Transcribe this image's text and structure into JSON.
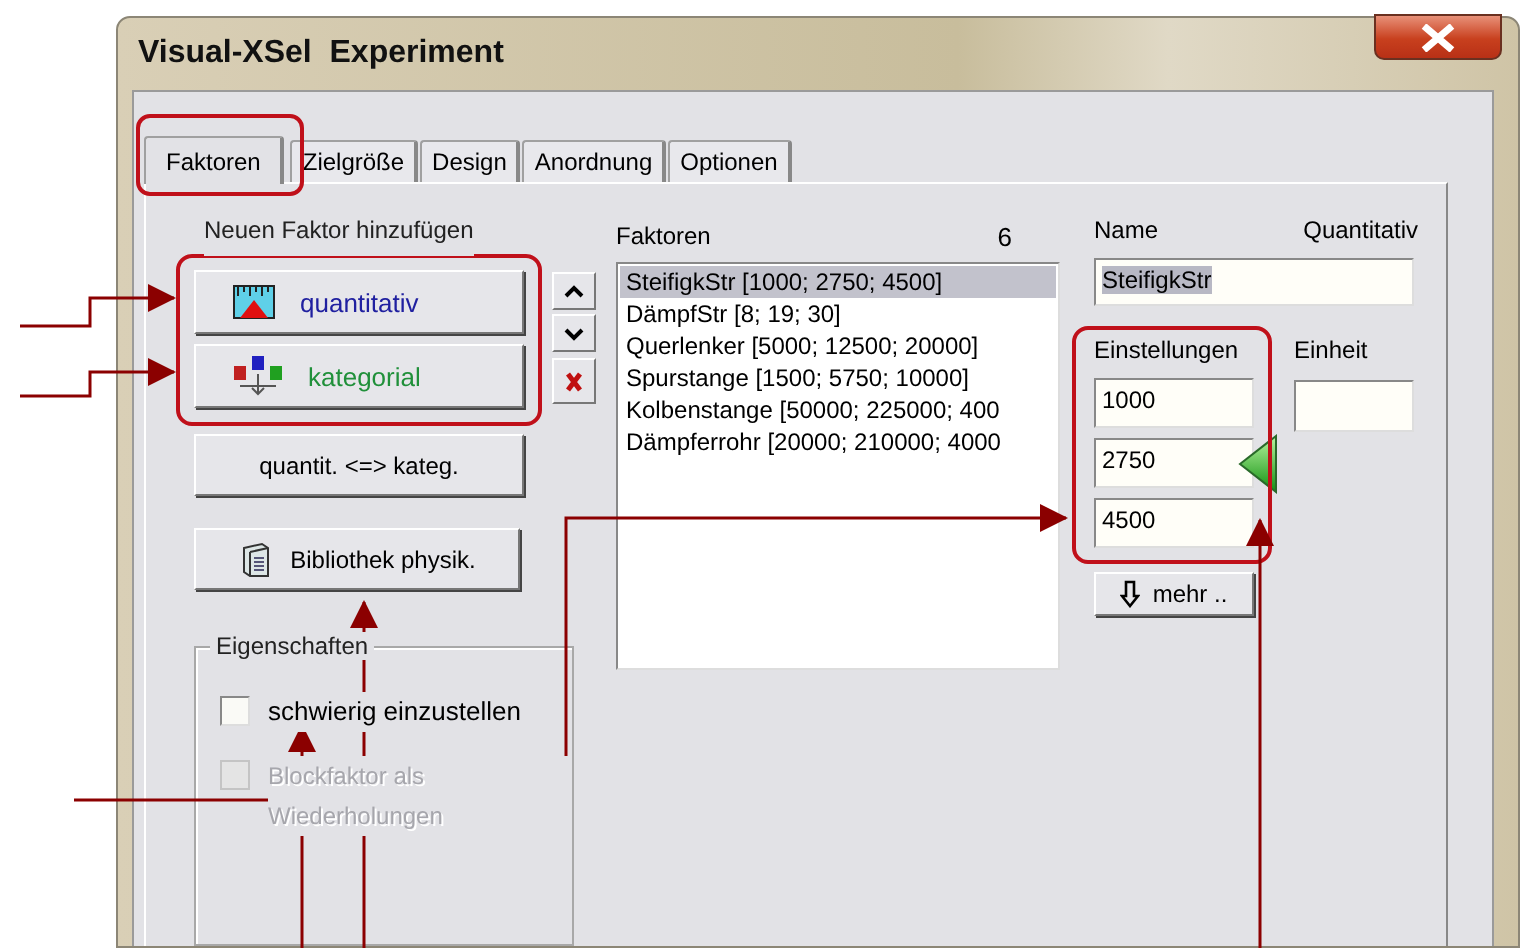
{
  "window": {
    "title": "Visual-XSel  Experiment"
  },
  "tabs": [
    {
      "label": "Faktoren",
      "selected": true
    },
    {
      "label": "Zielgröße",
      "selected": false
    },
    {
      "label": "Design",
      "selected": false
    },
    {
      "label": "Anordnung",
      "selected": false
    },
    {
      "label": "Optionen",
      "selected": false
    }
  ],
  "new_factor": {
    "label": "Neuen Faktor hinzufügen",
    "buttons": [
      {
        "kind": "quantitative",
        "label": "quantitativ"
      },
      {
        "kind": "categorical",
        "label": "kategorial"
      }
    ]
  },
  "convert_button": {
    "label": "quantit. <=>  kateg."
  },
  "library_button": {
    "label": "Bibliothek physik."
  },
  "factor_list": {
    "label": "Faktoren",
    "count": "6",
    "items": [
      {
        "label": "SteifigkStr [1000; 2750; 4500]",
        "selected": true
      },
      {
        "label": "DämpfStr [8; 19; 30]",
        "selected": false
      },
      {
        "label": "Querlenker [5000; 12500; 20000]",
        "selected": false
      },
      {
        "label": "Spurstange [1500; 5750; 10000]",
        "selected": false
      },
      {
        "label": "Kolbenstange [50000; 225000; 400",
        "selected": false
      },
      {
        "label": "Dämpferrohr [20000; 210000; 4000",
        "selected": false
      }
    ]
  },
  "factor_details": {
    "name_label": "Name",
    "type": "Quantitativ",
    "name_field": {
      "value": "SteifigkStr",
      "text_selected": true
    },
    "settings_label": "Einstellungen",
    "settings": [
      "1000",
      "2750",
      "4500"
    ],
    "unit_label": "Einheit",
    "more_button": {
      "label": "mehr .."
    }
  },
  "properties": {
    "title": "Eigenschaften",
    "options": [
      {
        "label": "schwierig einzustellen",
        "checked": false,
        "disabled": false
      },
      {
        "label": "Blockfaktor als Wiederholungen",
        "checked": false,
        "disabled": true
      }
    ]
  }
}
